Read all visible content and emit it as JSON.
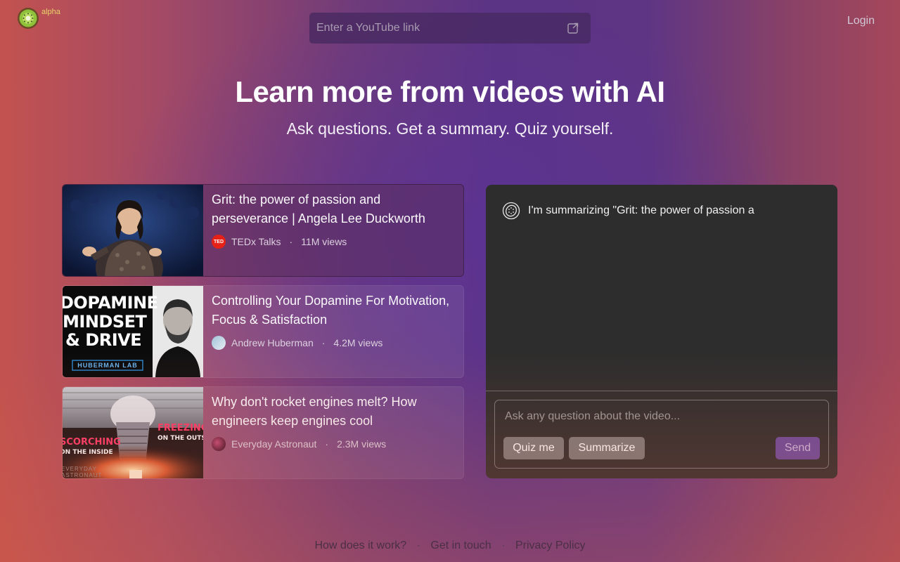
{
  "header": {
    "badge": "alpha",
    "search_placeholder": "Enter a YouTube link",
    "login_label": "Login"
  },
  "hero": {
    "title": "Learn more from videos with AI",
    "subtitle": "Ask questions. Get a summary. Quiz yourself."
  },
  "videos": [
    {
      "title": "Grit: the power of passion and perseverance | Angela Lee Duckworth",
      "channel": "TEDx Talks",
      "views": "11M views",
      "channel_avatar_text": "TED"
    },
    {
      "title": "Controlling Your Dopamine For Motivation, Focus & Satisfaction",
      "channel": "Andrew Huberman",
      "views": "4.2M views",
      "thumb_lines": [
        "DOPAMINE",
        "MINDSET",
        "& DRIVE"
      ],
      "thumb_brand": "HUBERMAN LAB"
    },
    {
      "title": "Why don't rocket engines melt? How engineers keep engines cool",
      "channel": "Everyday Astronaut",
      "views": "2.3M views",
      "thumb_left": "SCORCHING",
      "thumb_left_sub": "ON THE INSIDE",
      "thumb_right": "FREEZING",
      "thumb_right_sub": "ON THE OUTSIDE",
      "thumb_brand": "EVERYDAY ASTRONAUT"
    }
  ],
  "chat": {
    "message": "I'm summarizing \"Grit: the power of passion a",
    "input_placeholder": "Ask any question about the video...",
    "quiz_label": "Quiz me",
    "summarize_label": "Summarize",
    "send_label": "Send"
  },
  "footer": {
    "links": [
      "How does it work?",
      "Get in touch",
      "Privacy Policy"
    ],
    "separator": "·"
  },
  "colors": {
    "accent_send": "#6a4a9b",
    "chat_bg": "#2d2d2d",
    "badge": "#e9d36a"
  }
}
